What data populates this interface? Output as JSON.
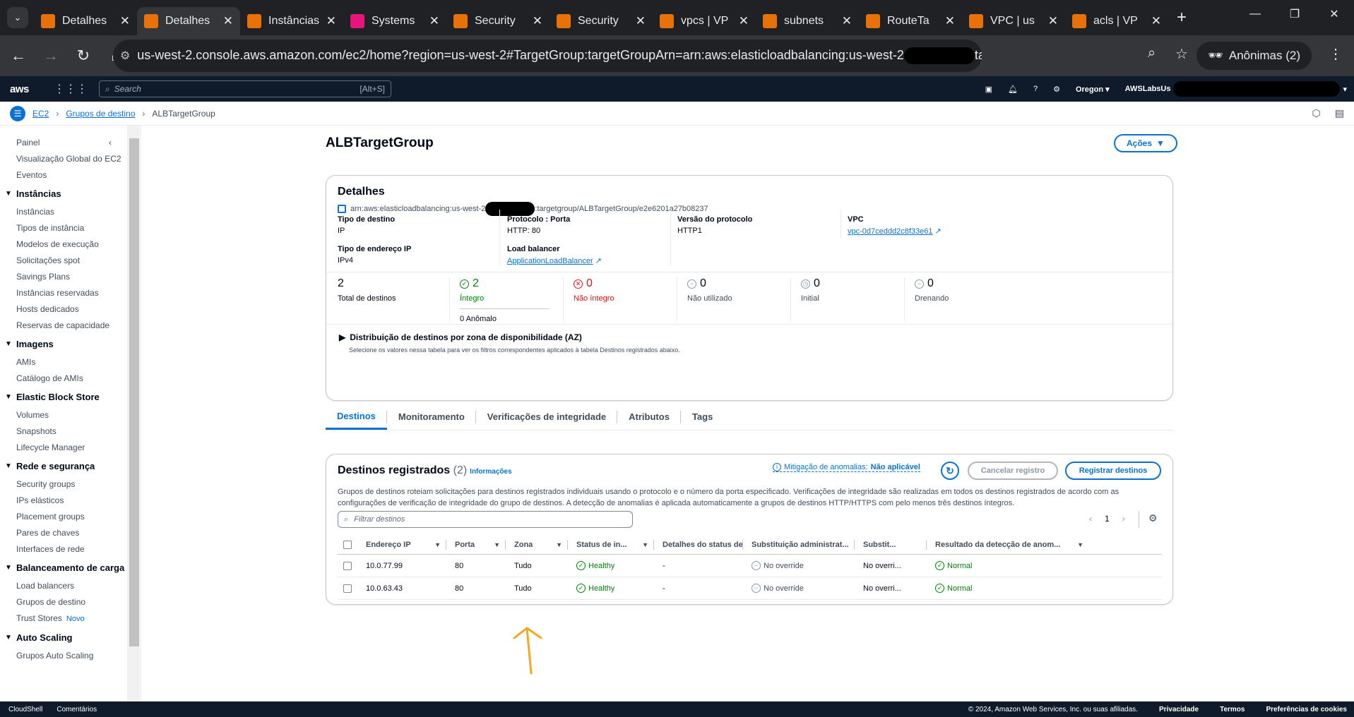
{
  "browser": {
    "tabs": [
      {
        "title": "Detalhes",
        "active": false,
        "favicon": "aws-ec2-icon",
        "color": "#e8710a"
      },
      {
        "title": "Detalhes",
        "active": true,
        "favicon": "aws-ec2-icon",
        "color": "#e8710a"
      },
      {
        "title": "Instâncias",
        "active": false,
        "favicon": "aws-ec2-icon",
        "color": "#e8710a"
      },
      {
        "title": "Systems",
        "active": false,
        "favicon": "aws-ssm-icon",
        "color": "#e7157b"
      },
      {
        "title": "Security",
        "active": false,
        "favicon": "aws-ec2-icon",
        "color": "#e8710a"
      },
      {
        "title": "Security",
        "active": false,
        "favicon": "aws-ec2-icon",
        "color": "#e8710a"
      },
      {
        "title": "vpcs | VP",
        "active": false,
        "favicon": "aws-vpc-icon",
        "color": "#e8710a"
      },
      {
        "title": "subnets",
        "active": false,
        "favicon": "aws-vpc-icon",
        "color": "#e8710a"
      },
      {
        "title": "RouteTa",
        "active": false,
        "favicon": "aws-vpc-icon",
        "color": "#e8710a"
      },
      {
        "title": "VPC | us",
        "active": false,
        "favicon": "aws-vpc-icon",
        "color": "#e8710a"
      },
      {
        "title": "acls | VP",
        "active": false,
        "favicon": "aws-vpc-icon",
        "color": "#e8710a"
      }
    ],
    "url_prefix": "us-west-2.console.aws.amazon.com/ec2/home?region=us-west-2#TargetGroup:targetGroupArn=arn:aws:elasticloadbalancing:us-west-2",
    "url_suffix": "targetgroup/ALBTargetG...",
    "profile_label": "Anônimas (2)"
  },
  "aws": {
    "logo": "aws",
    "search_placeholder": "Search",
    "search_shortcut": "[Alt+S]",
    "region": "Oregon ▾",
    "account": "AWSLabsUs"
  },
  "breadcrumb": {
    "root": "EC2",
    "parent": "Grupos de destino",
    "current": "ALBTargetGroup"
  },
  "sidebar": {
    "top": "Painel",
    "top_items": [
      "Visualização Global do EC2",
      "Eventos"
    ],
    "sections": [
      {
        "title": "Instâncias",
        "items": [
          "Instâncias",
          "Tipos de instância",
          "Modelos de execução",
          "Solicitações spot",
          "Savings Plans",
          "Instâncias reservadas",
          "Hosts dedicados",
          "Reservas de capacidade"
        ]
      },
      {
        "title": "Imagens",
        "items": [
          "AMIs",
          "Catálogo de AMIs"
        ]
      },
      {
        "title": "Elastic Block Store",
        "items": [
          "Volumes",
          "Snapshots",
          "Lifecycle Manager"
        ]
      },
      {
        "title": "Rede e segurança",
        "items": [
          "Security groups",
          "IPs elásticos",
          "Placement groups",
          "Pares de chaves",
          "Interfaces de rede"
        ]
      },
      {
        "title": "Balanceamento de carga",
        "items": [
          "Load balancers",
          "Grupos de destino",
          "Trust Stores"
        ]
      },
      {
        "title": "Auto Scaling",
        "items": [
          "Grupos Auto Scaling"
        ]
      }
    ],
    "new_badge": "Novo"
  },
  "page": {
    "title": "ALBTargetGroup",
    "actions_label": "Ações"
  },
  "details": {
    "heading": "Detalhes",
    "arn_prefix": "arn:aws:elasticloadbalancing:us-west-2",
    "arn_suffix": ":targetgroup/ALBTargetGroup/e2e6201a27b08237",
    "target_type_label": "Tipo de destino",
    "target_type": "IP",
    "protocol_label": "Protocolo : Porta",
    "protocol": "HTTP: 80",
    "protocol_version_label": "Versão do protocolo",
    "protocol_version": "HTTP1",
    "vpc_label": "VPC",
    "vpc": "vpc-0d7ceddd2c8f33e61",
    "ip_type_label": "Tipo de endereço IP",
    "ip_type": "IPv4",
    "lb_label": "Load balancer",
    "lb": "ApplicationLoadBalancer"
  },
  "stats": {
    "total": "2",
    "total_label": "Total de destinos",
    "healthy": "2",
    "healthy_label": "Íntegro",
    "anomalous": "0 Anômalo",
    "unhealthy": "0",
    "unhealthy_label": "Não íntegro",
    "unused": "0",
    "unused_label": "Não utilizado",
    "initial": "0",
    "initial_label": "Initial",
    "draining": "0",
    "draining_label": "Drenando"
  },
  "az": {
    "title": "Distribuição de destinos por zona de disponibilidade (AZ)",
    "subtitle": "Selecione os valores nessa tabela para ver os filtros correspondentes aplicados à tabela Destinos registrados abaixo."
  },
  "tabs": [
    "Destinos",
    "Monitoramento",
    "Verificações de integridade",
    "Atributos",
    "Tags"
  ],
  "targets": {
    "heading": "Destinos registrados",
    "count": "(2)",
    "info": "Informações",
    "anomaly_label": "Mitigação de anomalias:",
    "anomaly_value": "Não aplicável",
    "deregister": "Cancelar registro",
    "register": "Registrar destinos",
    "description": "Grupos de destinos roteiam solicitações para destinos registrados individuais usando o protocolo e o número da porta especificado. Verificações de integridade são realizadas em todos os destinos registrados de acordo com as configurações de verificação de integridade do grupo de destinos. A detecção de anomalias é aplicada automaticamente a grupos de destinos HTTP/HTTPS com pelo menos três destinos íntegros.",
    "filter_placeholder": "Filtrar destinos",
    "page": "1",
    "columns": [
      "Endereço IP",
      "Porta",
      "Zona",
      "Status de in...",
      "Detalhes do status de ...",
      "Substituição administrat...",
      "Substit...",
      "Resultado da detecção de anom..."
    ],
    "rows": [
      {
        "ip": "10.0.77.99",
        "port": "80",
        "zone": "Tudo",
        "status": "Healthy",
        "details": "-",
        "override": "No override",
        "subst": "No overri...",
        "result": "Normal"
      },
      {
        "ip": "10.0.63.43",
        "port": "80",
        "zone": "Tudo",
        "status": "Healthy",
        "details": "-",
        "override": "No override",
        "subst": "No overri...",
        "result": "Normal"
      }
    ]
  },
  "footer": {
    "cloudshell": "CloudShell",
    "feedback": "Comentários",
    "copyright": "© 2024, Amazon Web Services, Inc. ou suas afiliadas.",
    "privacy": "Privacidade",
    "terms": "Termos",
    "cookies": "Preferências de cookies"
  },
  "colors": {
    "link": "#0972d3",
    "success": "#037f0c",
    "error": "#d91515",
    "nav_bg": "#0f1b2a",
    "annotation_arrow": "#f5a623"
  }
}
